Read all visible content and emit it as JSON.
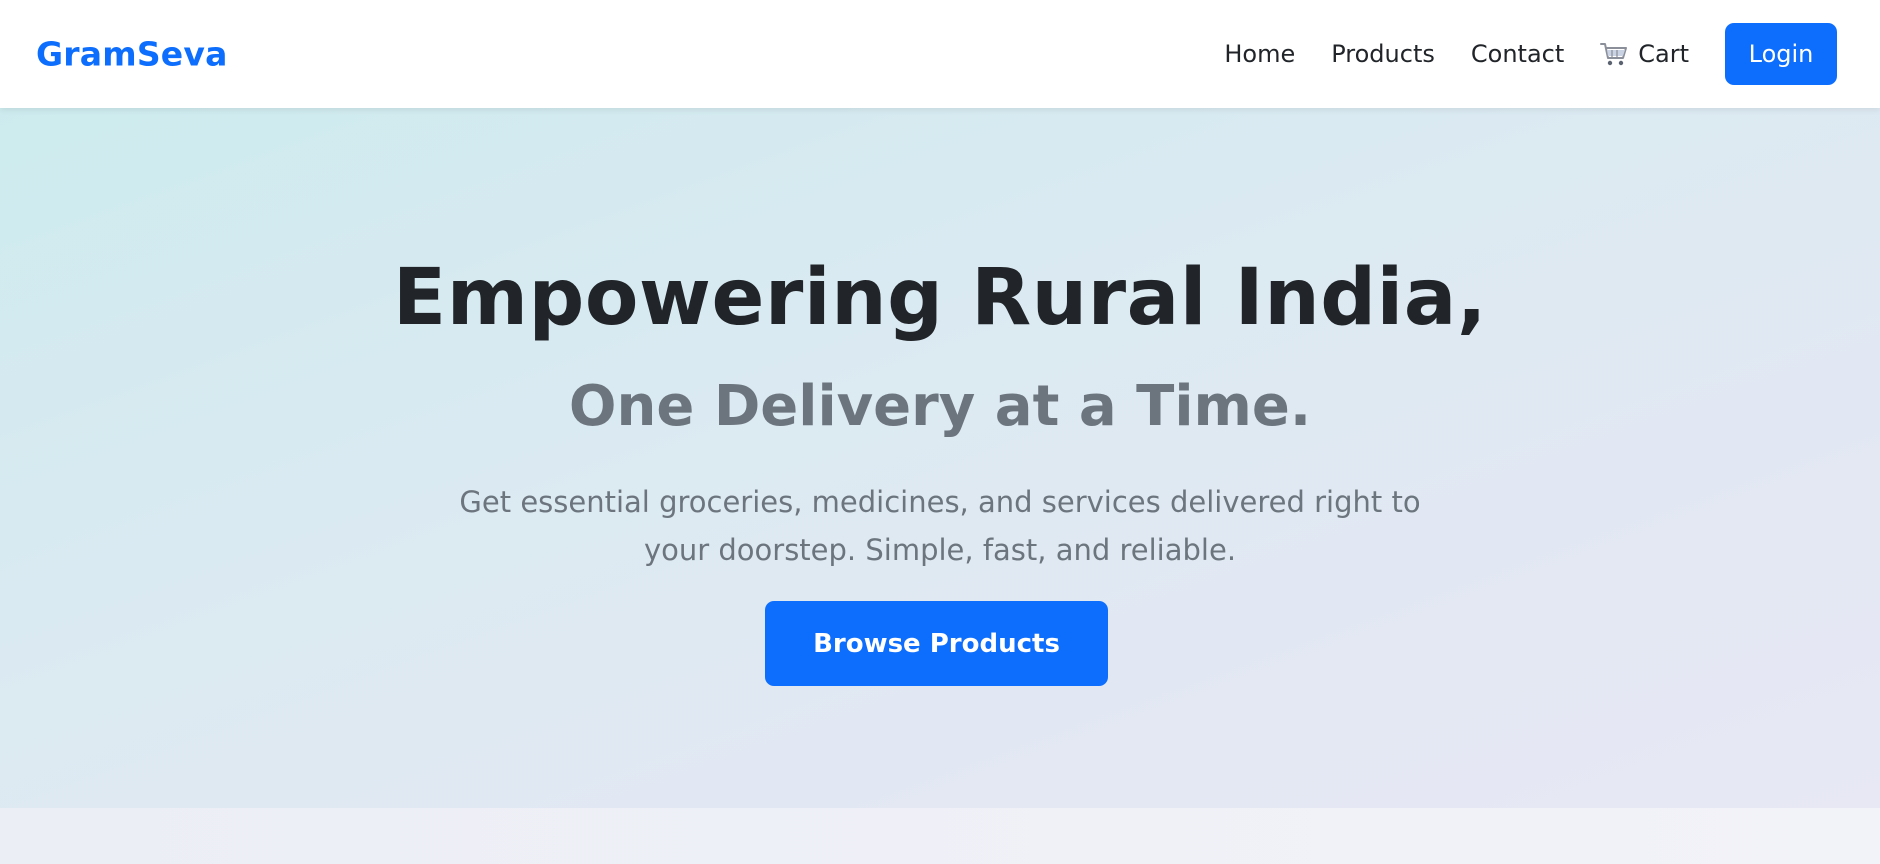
{
  "navbar": {
    "brand": "GramSeva",
    "links": [
      {
        "label": "Home"
      },
      {
        "label": "Products"
      },
      {
        "label": "Contact"
      }
    ],
    "cart": {
      "label": "Cart",
      "icon": "cart-icon"
    },
    "login_label": "Login"
  },
  "hero": {
    "title": "Empowering Rural India,",
    "subtitle": "One Delivery at a Time.",
    "description": "Get essential groceries, medicines, and services delivered right to your doorstep. Simple, fast, and reliable.",
    "cta_label": "Browse Products"
  },
  "colors": {
    "primary": "#0d6efd",
    "heading": "#212529",
    "muted": "#6c757d",
    "hero_gradient_start": "#cdebee",
    "hero_gradient_end": "#e7e8f4"
  }
}
